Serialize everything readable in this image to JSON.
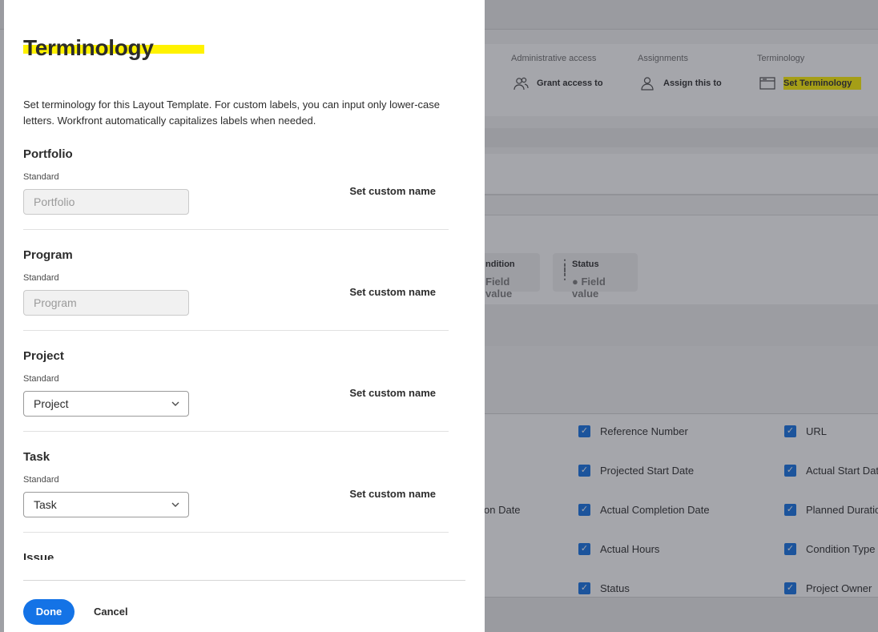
{
  "background": {
    "columns": [
      {
        "header": "Administrative access",
        "action": "Grant access to",
        "icon": "people-icon"
      },
      {
        "header": "Assignments",
        "action": "Assign this to",
        "icon": "person-icon"
      },
      {
        "header": "Terminology",
        "action": "Set Terminology",
        "icon": "window-icon"
      }
    ],
    "fields": [
      {
        "label": "ndition",
        "value": "Field value"
      },
      {
        "label": "Status",
        "value": "Field value"
      }
    ],
    "checkboxes": {
      "col1": [
        "Reference Number",
        "Projected Start Date",
        "Actual Completion Date",
        "Actual Hours",
        "Status"
      ],
      "col2": [
        "URL",
        "Actual Start Dat",
        "Planned Duratio",
        "Condition Type",
        "Project Owner"
      ],
      "partial": "on Date"
    }
  },
  "panel": {
    "title": "Terminology",
    "description": "Set terminology for this Layout Template. For custom labels, you can input only lower-case letters. Workfront automatically capitalizes labels when needed.",
    "items": [
      {
        "name": "Portfolio",
        "standard_label": "Standard",
        "value": "Portfolio",
        "editable": false,
        "custom_label": "Set custom name"
      },
      {
        "name": "Program",
        "standard_label": "Standard",
        "value": "Program",
        "editable": false,
        "custom_label": "Set custom name"
      },
      {
        "name": "Project",
        "standard_label": "Standard",
        "value": "Project",
        "editable": true,
        "custom_label": "Set custom name"
      },
      {
        "name": "Task",
        "standard_label": "Standard",
        "value": "Task",
        "editable": true,
        "custom_label": "Set custom name"
      },
      {
        "name": "Issue"
      }
    ],
    "done_label": "Done",
    "cancel_label": "Cancel"
  },
  "colors": {
    "accent": "#1473e6",
    "highlight": "#fff200"
  }
}
